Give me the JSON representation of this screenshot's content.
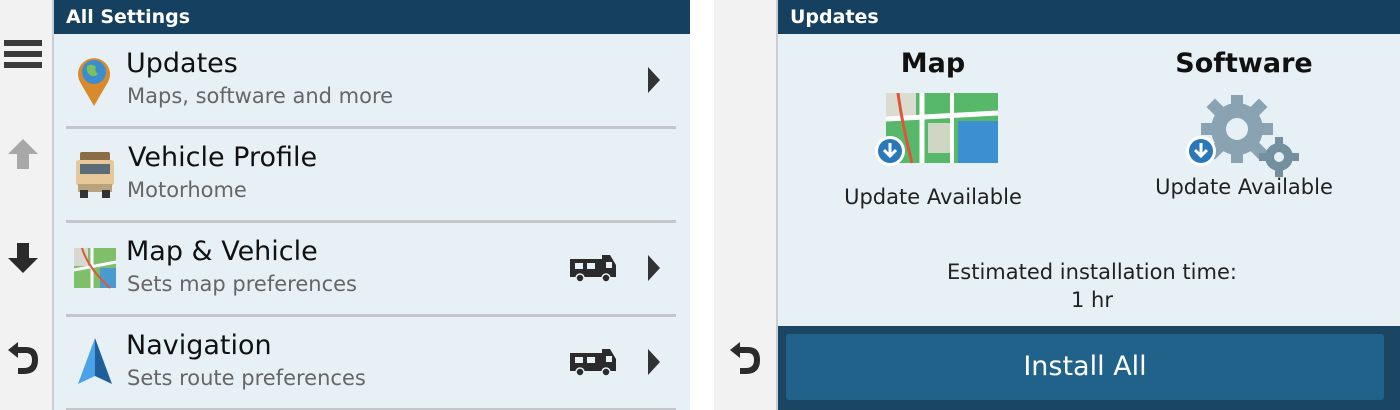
{
  "left": {
    "title": "All Settings",
    "side_buttons": [
      "menu-icon",
      "arrow-up-icon",
      "arrow-down-icon",
      "back-icon"
    ],
    "items": [
      {
        "icon": "update-pin-icon",
        "title": "Updates",
        "subtitle": "Maps, software and more",
        "rv_icon": false
      },
      {
        "icon": "motorhome-icon",
        "title": "Vehicle Profile",
        "subtitle": "Motorhome",
        "rv_icon": false
      },
      {
        "icon": "map-icon",
        "title": "Map & Vehicle",
        "subtitle": "Sets map preferences",
        "rv_icon": true
      },
      {
        "icon": "navigation-arrow-icon",
        "title": "Navigation",
        "subtitle": "Sets route preferences",
        "rv_icon": true
      }
    ]
  },
  "right": {
    "title": "Updates",
    "map": {
      "heading": "Map",
      "status": "Update Available"
    },
    "software": {
      "heading": "Software",
      "status": "Update Available"
    },
    "estimate_label": "Estimated installation time:",
    "estimate_value": "1 hr",
    "install_label": "Install All"
  },
  "colors": {
    "title_bar": "#15405f",
    "background": "#e7f0f5",
    "button": "#21628b"
  }
}
